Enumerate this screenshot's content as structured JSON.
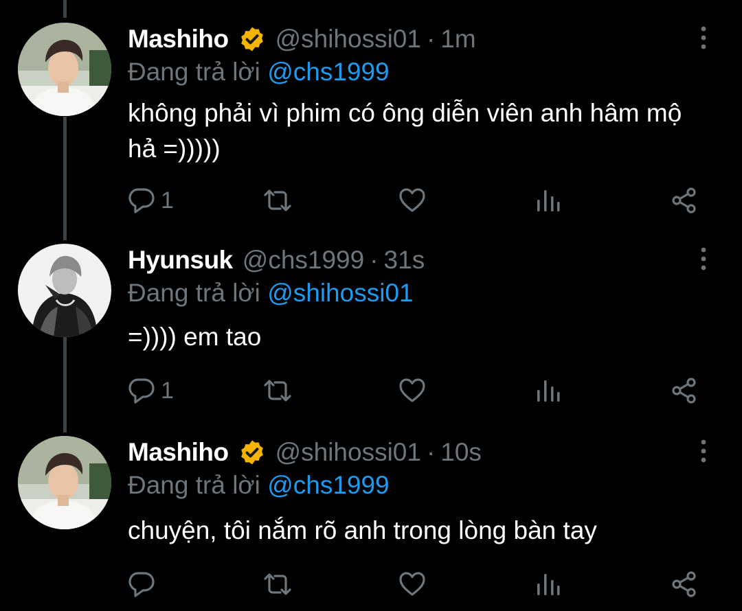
{
  "colors": {
    "background": "#000000",
    "text": "#ffffff",
    "muted": "#6e767d",
    "mention": "#1d9bf0",
    "verified": "#f4b400",
    "thread_line": "#3d4449"
  },
  "tweets": [
    {
      "name": "Mashiho",
      "verified": true,
      "handle": "@shihossi01",
      "separator": "·",
      "time": "1m",
      "reply_prefix": "Đang trả lời",
      "reply_to": "@chs1999",
      "text": "không phải vì phim có ông diễn viên anh hâm mộ hả =)))))",
      "reply_count": "1",
      "icons": [
        "reply-icon",
        "retweet-icon",
        "like-icon",
        "analytics-icon",
        "share-icon"
      ]
    },
    {
      "name": "Hyunsuk",
      "verified": false,
      "handle": "@chs1999",
      "separator": "·",
      "time": "31s",
      "reply_prefix": "Đang trả lời",
      "reply_to": "@shihossi01",
      "text": "=)))) em tao",
      "reply_count": "1",
      "icons": [
        "reply-icon",
        "retweet-icon",
        "like-icon",
        "analytics-icon",
        "share-icon"
      ]
    },
    {
      "name": "Mashiho",
      "verified": true,
      "handle": "@shihossi01",
      "separator": "·",
      "time": "10s",
      "reply_prefix": "Đang trả lời",
      "reply_to": "@chs1999",
      "text": "chuyện, tôi nắm rõ anh trong lòng bàn tay",
      "reply_count": "",
      "icons": [
        "reply-icon",
        "retweet-icon",
        "like-icon",
        "analytics-icon",
        "share-icon"
      ]
    }
  ]
}
